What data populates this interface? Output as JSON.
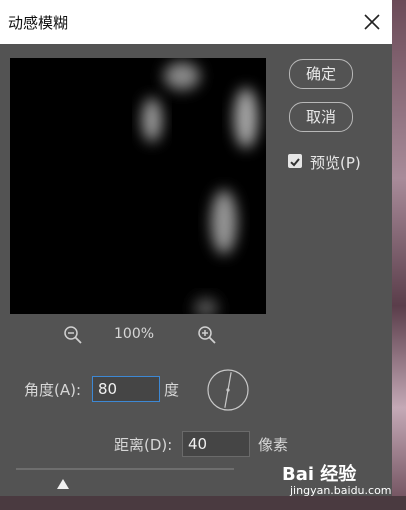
{
  "dialog": {
    "title": "动感模糊",
    "ok_label": "确定",
    "cancel_label": "取消",
    "preview_label": "预览(P)",
    "preview_checked": true,
    "zoom_level": "100%",
    "angle_label": "角度(A):",
    "angle_value": "80",
    "angle_unit": "度",
    "distance_label": "距离(D):",
    "distance_value": "40",
    "distance_unit": "像素",
    "distance_slider_fraction": 0.2
  },
  "icons": {
    "close": "close-icon",
    "zoom_out": "zoom-out-icon",
    "zoom_in": "zoom-in-icon",
    "checkbox": "check-icon",
    "angle_dial": "angle-dial-icon",
    "slider_thumb": "triangle-up-icon"
  },
  "watermark": {
    "logo": "Bai 经验",
    "url": "jingyan.baidu.com"
  },
  "colors": {
    "dialog_bg": "#535353",
    "focus_border": "#3d88d4"
  }
}
